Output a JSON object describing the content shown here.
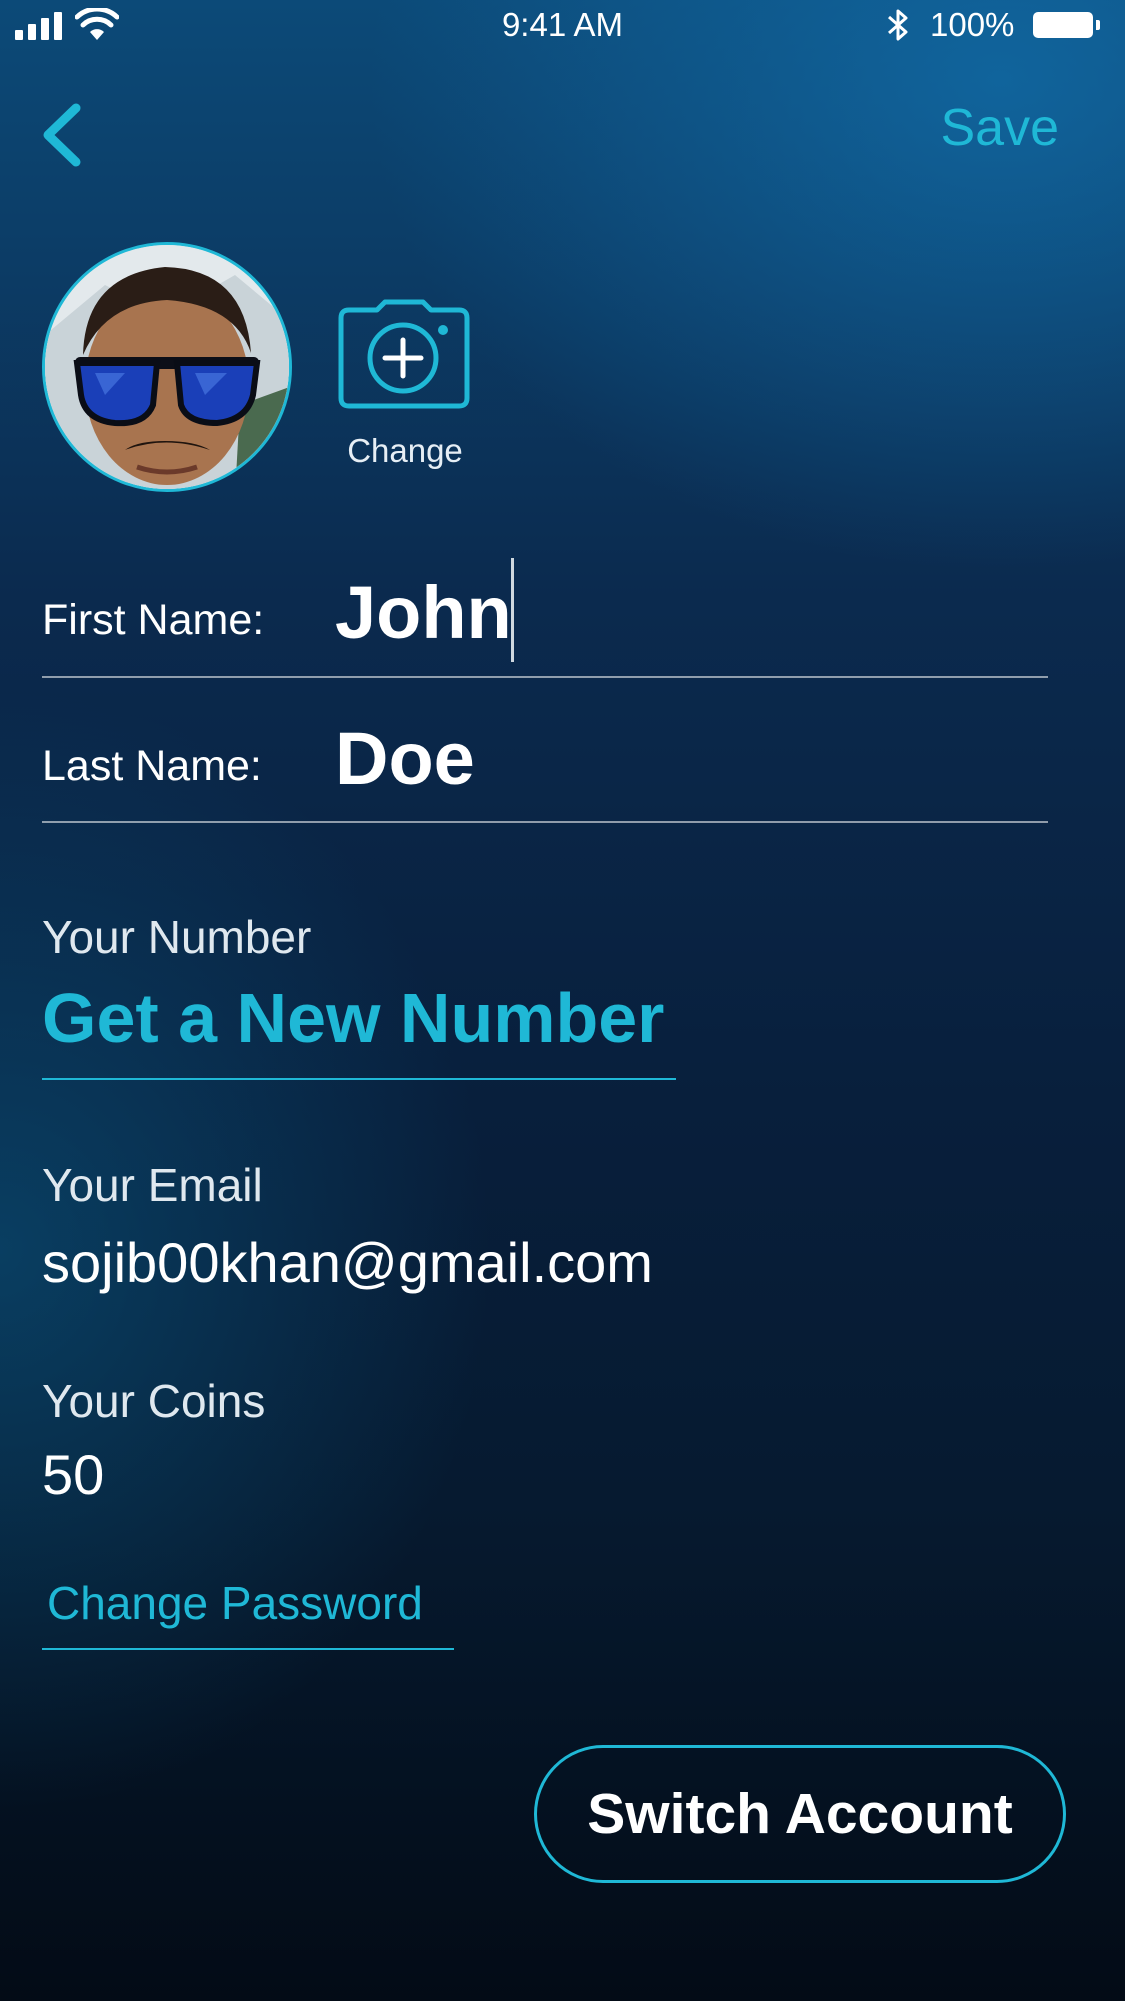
{
  "status_bar": {
    "time": "9:41 AM",
    "battery_percent": "100%",
    "signal_icon": "cellular-signal-icon",
    "wifi_icon": "wifi-icon",
    "bluetooth_icon": "bluetooth-icon",
    "battery_icon": "battery-icon",
    "battery_level": 1.0
  },
  "header": {
    "back_icon": "chevron-left-icon",
    "save_label": "Save"
  },
  "profile": {
    "avatar_icon": "profile-photo",
    "camera_icon": "camera-plus-icon",
    "change_label": "Change"
  },
  "form": {
    "first_name_label": "First Name:",
    "first_name_value": "John",
    "last_name_label": "Last Name:",
    "last_name_value": "Doe"
  },
  "number": {
    "label": "Your Number",
    "link": "Get a New Number"
  },
  "email": {
    "label": "Your Email",
    "value": "sojib00khan@gmail.com"
  },
  "coins": {
    "label": "Your Coins",
    "value": "50"
  },
  "change_password_label": "Change Password",
  "switch_account_label": "Switch Account",
  "colors": {
    "accent": "#1fb8d6",
    "text": "#ffffff",
    "background_top": "#0c4a78",
    "background_bottom": "#030b16"
  }
}
